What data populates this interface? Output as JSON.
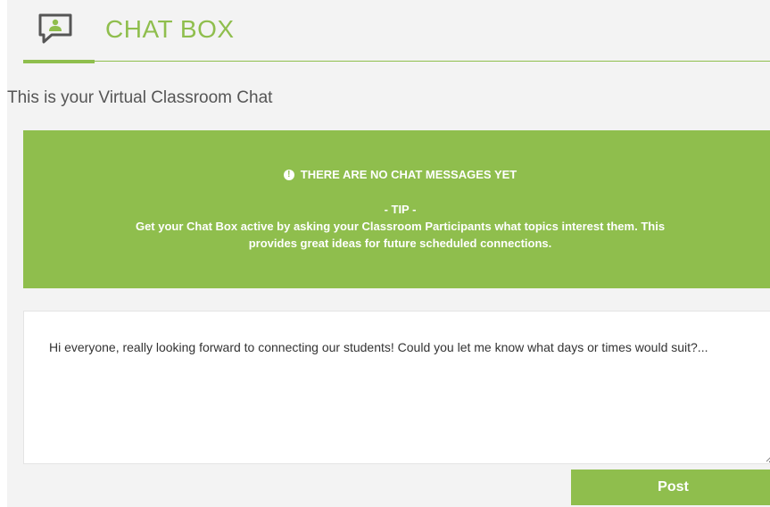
{
  "header": {
    "title": "CHAT BOX",
    "icon": "chat-user-icon"
  },
  "subtitle": "This is your Virtual Classroom Chat",
  "notice": {
    "heading": "THERE ARE NO CHAT MESSAGES YET",
    "icon": "exclamation-circle-icon",
    "tip_label": "- TIP -",
    "tip_text": "Get your Chat Box active by asking your Classroom Participants what topics interest them. This provides great ideas for future scheduled connections."
  },
  "compose": {
    "value": "Hi everyone, really looking forward to connecting our students! Could you let me know what days or times would suit?...",
    "post_label": "Post"
  },
  "colors": {
    "accent": "#8fbe4d",
    "background": "#f3f3f3",
    "text": "#555555"
  }
}
